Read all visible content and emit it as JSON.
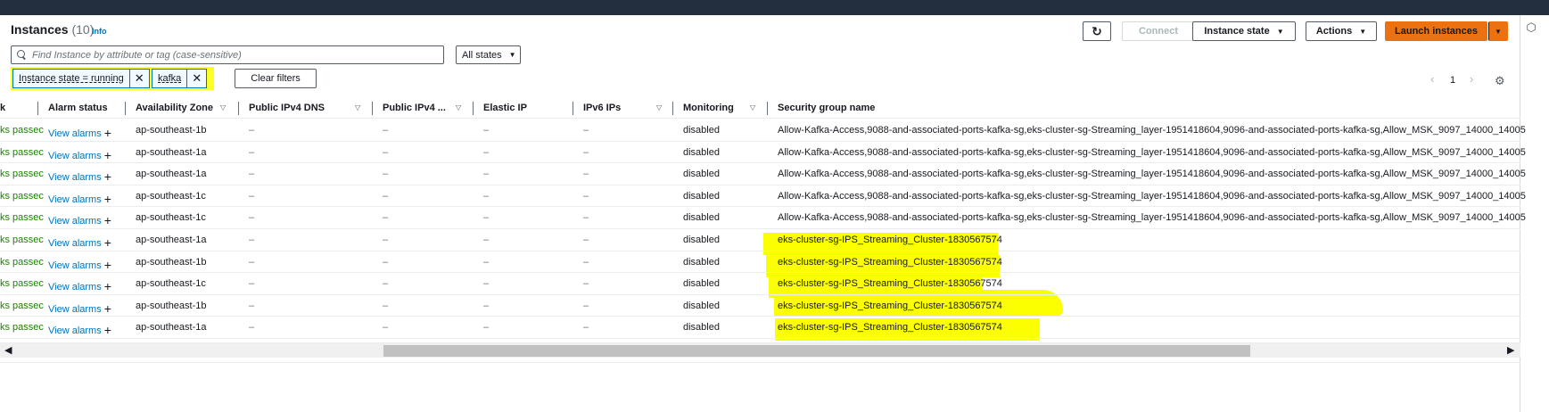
{
  "header": {
    "title": "Instances",
    "count": "(10)",
    "info": "Info"
  },
  "toolbar": {
    "connect": "Connect",
    "instance_state": "Instance state",
    "actions": "Actions",
    "launch": "Launch instances"
  },
  "search": {
    "placeholder": "Find Instance by attribute or tag (case-sensitive)",
    "states_select": "All states"
  },
  "filters": {
    "tokens": [
      "Instance state = running",
      "kafka"
    ],
    "clear_label": "Clear filters"
  },
  "pagination": {
    "page": "1"
  },
  "columns": [
    {
      "label": "Alarm status"
    },
    {
      "label": "Availability Zone"
    },
    {
      "label": "Public IPv4 DNS"
    },
    {
      "label": "Public IPv4 ..."
    },
    {
      "label": "Elastic IP"
    },
    {
      "label": "IPv6 IPs"
    },
    {
      "label": "Monitoring"
    },
    {
      "label": "Security group name"
    }
  ],
  "rows": [
    {
      "status": "ks passec",
      "alarm": "View alarms",
      "az": "ap-southeast-1b",
      "dns": "–",
      "ipv4": "–",
      "eip": "–",
      "ipv6": "–",
      "monitoring": "disabled",
      "sg": "Allow-Kafka-Access,9088-and-associated-ports-kafka-sg,eks-cluster-sg-Streaming_layer-1951418604,9096-and-associated-ports-kafka-sg,Allow_MSK_9097_14000_14005"
    },
    {
      "status": "ks passec",
      "alarm": "View alarms",
      "az": "ap-southeast-1a",
      "dns": "–",
      "ipv4": "–",
      "eip": "–",
      "ipv6": "–",
      "monitoring": "disabled",
      "sg": "Allow-Kafka-Access,9088-and-associated-ports-kafka-sg,eks-cluster-sg-Streaming_layer-1951418604,9096-and-associated-ports-kafka-sg,Allow_MSK_9097_14000_14005"
    },
    {
      "status": "ks passec",
      "alarm": "View alarms",
      "az": "ap-southeast-1a",
      "dns": "–",
      "ipv4": "–",
      "eip": "–",
      "ipv6": "–",
      "monitoring": "disabled",
      "sg": "Allow-Kafka-Access,9088-and-associated-ports-kafka-sg,eks-cluster-sg-Streaming_layer-1951418604,9096-and-associated-ports-kafka-sg,Allow_MSK_9097_14000_14005"
    },
    {
      "status": "ks passec",
      "alarm": "View alarms",
      "az": "ap-southeast-1c",
      "dns": "–",
      "ipv4": "–",
      "eip": "–",
      "ipv6": "–",
      "monitoring": "disabled",
      "sg": "Allow-Kafka-Access,9088-and-associated-ports-kafka-sg,eks-cluster-sg-Streaming_layer-1951418604,9096-and-associated-ports-kafka-sg,Allow_MSK_9097_14000_14005"
    },
    {
      "status": "ks passec",
      "alarm": "View alarms",
      "az": "ap-southeast-1c",
      "dns": "–",
      "ipv4": "–",
      "eip": "–",
      "ipv6": "–",
      "monitoring": "disabled",
      "sg": "Allow-Kafka-Access,9088-and-associated-ports-kafka-sg,eks-cluster-sg-Streaming_layer-1951418604,9096-and-associated-ports-kafka-sg,Allow_MSK_9097_14000_14005"
    },
    {
      "status": "ks passec",
      "alarm": "View alarms",
      "az": "ap-southeast-1a",
      "dns": "–",
      "ipv4": "–",
      "eip": "–",
      "ipv6": "–",
      "monitoring": "disabled",
      "sg": "eks-cluster-sg-IPS_Streaming_Cluster-1830567574"
    },
    {
      "status": "ks passec",
      "alarm": "View alarms",
      "az": "ap-southeast-1b",
      "dns": "–",
      "ipv4": "–",
      "eip": "–",
      "ipv6": "–",
      "monitoring": "disabled",
      "sg": "eks-cluster-sg-IPS_Streaming_Cluster-1830567574"
    },
    {
      "status": "ks passec",
      "alarm": "View alarms",
      "az": "ap-southeast-1c",
      "dns": "–",
      "ipv4": "–",
      "eip": "–",
      "ipv6": "–",
      "monitoring": "disabled",
      "sg": "eks-cluster-sg-IPS_Streaming_Cluster-1830567574"
    },
    {
      "status": "ks passec",
      "alarm": "View alarms",
      "az": "ap-southeast-1b",
      "dns": "–",
      "ipv4": "–",
      "eip": "–",
      "ipv6": "–",
      "monitoring": "disabled",
      "sg": "eks-cluster-sg-IPS_Streaming_Cluster-1830567574"
    },
    {
      "status": "ks passec",
      "alarm": "View alarms",
      "az": "ap-southeast-1a",
      "dns": "–",
      "ipv4": "–",
      "eip": "–",
      "ipv6": "–",
      "monitoring": "disabled",
      "sg": "eks-cluster-sg-IPS_Streaming_Cluster-1830567574"
    }
  ],
  "colors": {
    "header_bar": "#232f3e",
    "link": "#0073bb",
    "primary": "#ec7211",
    "status_ok": "#1d8102",
    "highlight": "#fbff00"
  },
  "icons": {
    "refresh": "refresh-icon",
    "search": "search-icon",
    "remove_token": "close-icon",
    "settings": "gear-icon",
    "add": "plus-icon"
  }
}
